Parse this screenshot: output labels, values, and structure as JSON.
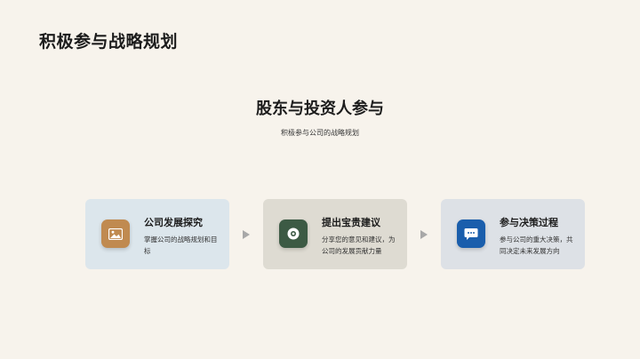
{
  "slide": {
    "title": "积极参与战略规划",
    "heading": "股东与投资人参与",
    "subheading": "积极参与公司的战略规划"
  },
  "cards": [
    {
      "icon": "image-icon",
      "icon_color": "#c08a50",
      "title": "公司发展探究",
      "desc": "掌握公司的战略规划和目标"
    },
    {
      "icon": "circle-dot-icon",
      "icon_color": "#3c5a44",
      "title": "提出宝贵建议",
      "desc": "分享您的意见和建议，为公司的发展贡献力量"
    },
    {
      "icon": "chat-bubble-icon",
      "icon_color": "#1a5eac",
      "title": "参与决策过程",
      "desc": "参与公司的重大决策，共同决定未来发展方向"
    }
  ]
}
